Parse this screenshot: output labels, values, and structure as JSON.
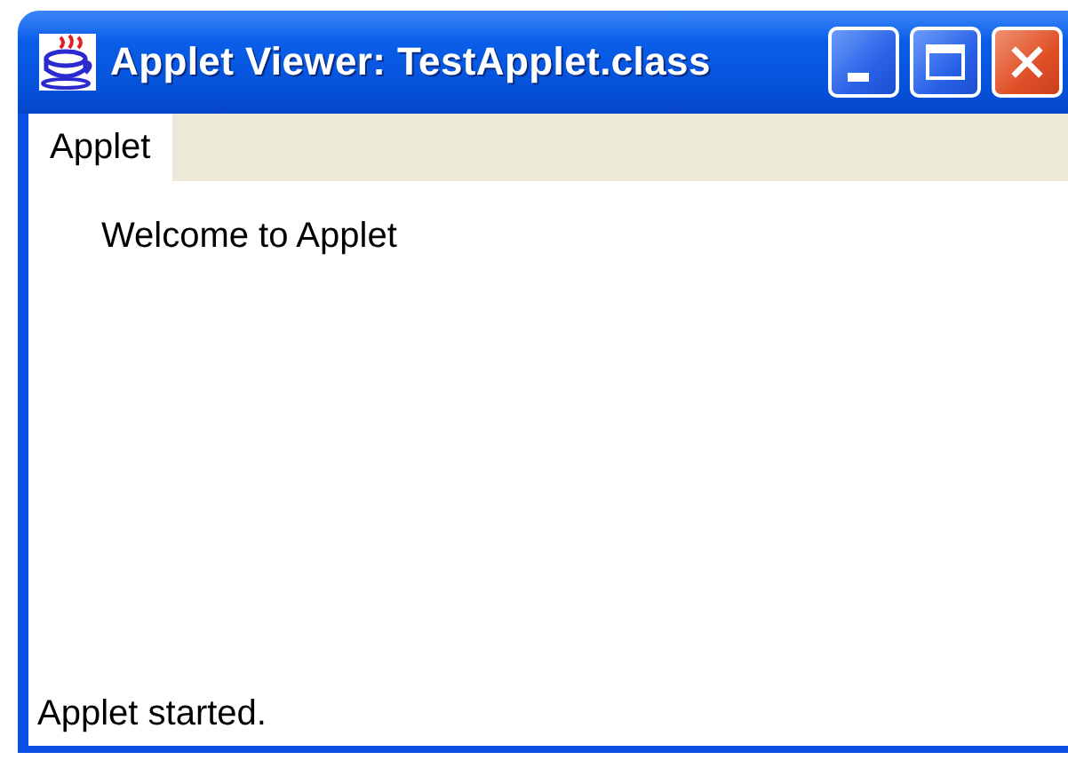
{
  "window": {
    "title": "Applet Viewer: TestApplet.class"
  },
  "menu_bar": {
    "items": [
      {
        "label": "Applet",
        "selected": true
      }
    ]
  },
  "applet": {
    "text": "Welcome to Applet"
  },
  "status_bar": "Applet started."
}
